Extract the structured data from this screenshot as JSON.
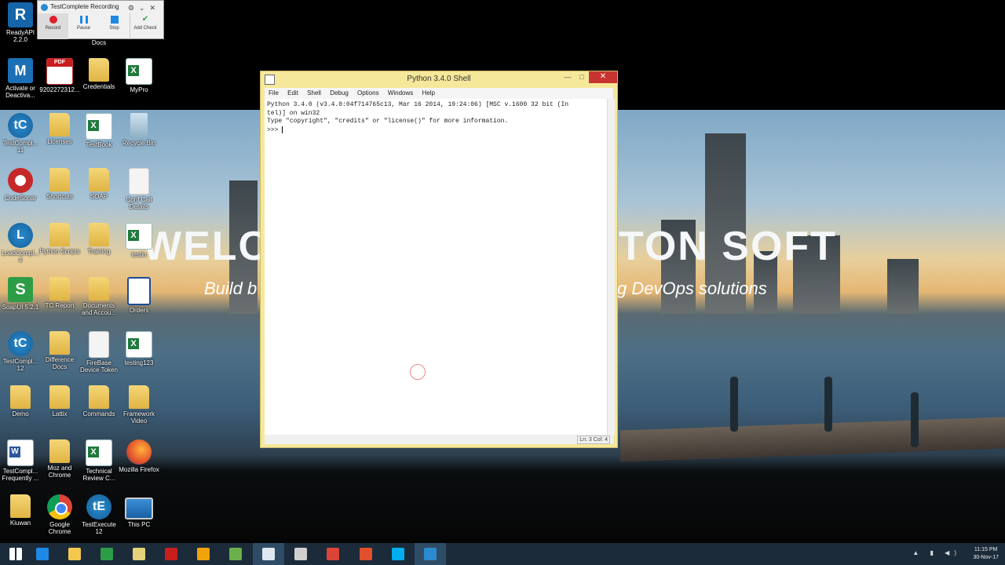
{
  "wallpaper": {
    "headline_left": "WELCO",
    "headline_right": "TON SOFT",
    "tagline_left": "Build b",
    "tagline_right": "g DevOps solutions"
  },
  "recording_toolbar": {
    "title": "TestComplete Recording",
    "buttons": [
      {
        "label": "Record",
        "icon": "record-icon",
        "color": "#e0202a"
      },
      {
        "label": "Pause",
        "icon": "pause-icon",
        "color": "#1e88e5"
      },
      {
        "label": "Stop",
        "icon": "stop-icon",
        "color": "#1e88e5"
      },
      {
        "label": "Add Check",
        "icon": "add-check-icon",
        "color": "#2e9c46"
      }
    ]
  },
  "desktop_icons": [
    {
      "label": "ReadyAPI 2.2.0",
      "icon": "readyapi-icon"
    },
    {
      "label": "Docs",
      "icon": "folder-icon"
    },
    {
      "label": "Activate or Deactiva...",
      "icon": "license-manager-icon"
    },
    {
      "label": "9202272312...",
      "icon": "pdf-icon"
    },
    {
      "label": "Credentials",
      "icon": "folder-icon"
    },
    {
      "label": "MyPro",
      "icon": "excel-icon"
    },
    {
      "label": "TestCompl... 11",
      "icon": "testcomplete-icon"
    },
    {
      "label": "Licenses",
      "icon": "folder-icon"
    },
    {
      "label": "TestBook",
      "icon": "excel-icon"
    },
    {
      "label": "Recycle Bin",
      "icon": "recycle-bin-icon"
    },
    {
      "label": "CodeSonar",
      "icon": "codesonar-icon"
    },
    {
      "label": "Shortcuts",
      "icon": "folder-icon"
    },
    {
      "label": "SOAP",
      "icon": "folder-icon"
    },
    {
      "label": "Conf Call Details",
      "icon": "document-icon"
    },
    {
      "label": "LoadCompl... 4",
      "icon": "loadcomplete-icon"
    },
    {
      "label": "Python Scripts",
      "icon": "folder-icon"
    },
    {
      "label": "Training",
      "icon": "folder-icon"
    },
    {
      "label": "testin",
      "icon": "excel-icon"
    },
    {
      "label": "SoapUI 5.2.1",
      "icon": "soapui-icon"
    },
    {
      "label": "TC Report",
      "icon": "folder-icon"
    },
    {
      "label": "Documents and Accou...",
      "icon": "folder-icon"
    },
    {
      "label": "Orders",
      "icon": "orders-icon"
    },
    {
      "label": "TestCompl... 12",
      "icon": "testcomplete-icon"
    },
    {
      "label": "Difference Docs",
      "icon": "folder-icon"
    },
    {
      "label": "FireBase Device Token",
      "icon": "document-icon"
    },
    {
      "label": "testing123",
      "icon": "excel-icon"
    },
    {
      "label": "Demo",
      "icon": "folder-icon"
    },
    {
      "label": "Lattix",
      "icon": "folder-icon"
    },
    {
      "label": "Commands",
      "icon": "folder-icon"
    },
    {
      "label": "Framework Video",
      "icon": "folder-icon"
    },
    {
      "label": "TestCompl... Frequently ...",
      "icon": "word-icon"
    },
    {
      "label": "Moz and Chrome",
      "icon": "folder-icon"
    },
    {
      "label": "Technical Review C...",
      "icon": "excel-icon"
    },
    {
      "label": "Mozilla Firefox",
      "icon": "firefox-icon"
    },
    {
      "label": "Kiuwan",
      "icon": "folder-icon"
    },
    {
      "label": "Google Chrome",
      "icon": "chrome-icon"
    },
    {
      "label": "TestExecute 12",
      "icon": "testexecute-icon"
    },
    {
      "label": "This PC",
      "icon": "this-pc-icon"
    }
  ],
  "python_window": {
    "title": "Python 3.4.0 Shell",
    "menu": [
      "File",
      "Edit",
      "Shell",
      "Debug",
      "Options",
      "Windows",
      "Help"
    ],
    "lines": [
      "Python 3.4.0 (v3.4.0:04f714765c13, Mar 16 2014, 19:24:06) [MSC v.1600 32 bit (In",
      "tel)] on win32",
      "Type \"copyright\", \"credits\" or \"license()\" for more information.",
      ">>> "
    ],
    "status": "Ln: 3 Col: 4"
  },
  "taskbar": {
    "apps": [
      {
        "name": "start-icon",
        "color": "#ffffff"
      },
      {
        "name": "internet-explorer-icon",
        "color": "#1e88e5"
      },
      {
        "name": "file-explorer-icon",
        "color": "#f4c84f"
      },
      {
        "name": "store-icon",
        "color": "#2e9c46"
      },
      {
        "name": "folder-shortcut-icon",
        "color": "#e6d27a"
      },
      {
        "name": "acrobat-icon",
        "color": "#c71f1f"
      },
      {
        "name": "outlook-icon",
        "color": "#f0a30a"
      },
      {
        "name": "android-studio-icon",
        "color": "#6ab04c"
      },
      {
        "name": "python-idle-icon",
        "color": "#dfe7f0"
      },
      {
        "name": "sniffer-icon",
        "color": "#d0d0d0"
      },
      {
        "name": "chrome-taskbar-icon",
        "color": "#db4437"
      },
      {
        "name": "firefox-taskbar-icon",
        "color": "#e2502b"
      },
      {
        "name": "skype-icon",
        "color": "#00aff0"
      },
      {
        "name": "testcomplete-taskbar-icon",
        "color": "#2a8bd0"
      }
    ],
    "time": "11:15 PM",
    "date": "30-Nov-17"
  }
}
